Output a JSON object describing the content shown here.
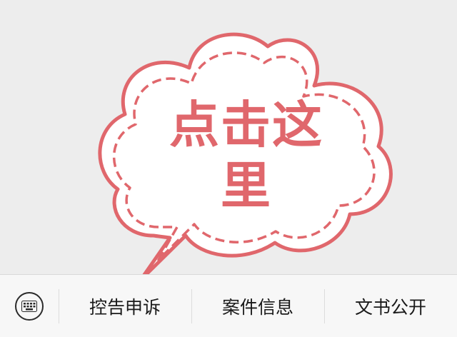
{
  "bubble": {
    "line1": "点击这",
    "line2": "里",
    "color": "#e0676c"
  },
  "menu": {
    "keyboard_icon": "keyboard-icon",
    "items": [
      {
        "label": "控告申诉"
      },
      {
        "label": "案件信息"
      },
      {
        "label": "文书公开"
      }
    ]
  }
}
